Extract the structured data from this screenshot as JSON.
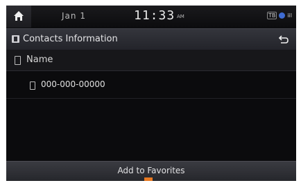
{
  "status_bar": {
    "date": "Jan  1",
    "time": "11:33",
    "ampm": "AM",
    "icons": [
      "home-icon",
      "tb-badge-icon",
      "bluetooth-icon",
      "signal-icon"
    ],
    "badge_text": "TB",
    "signal_text": "iil"
  },
  "title_bar": {
    "title": "Contacts Information",
    "back_icon": "back-arrow-icon"
  },
  "contact": {
    "name": "Name",
    "numbers": [
      "000-000-00000"
    ]
  },
  "bottom": {
    "favorites_label": "Add to Favorites",
    "accent": "#e87a22"
  }
}
